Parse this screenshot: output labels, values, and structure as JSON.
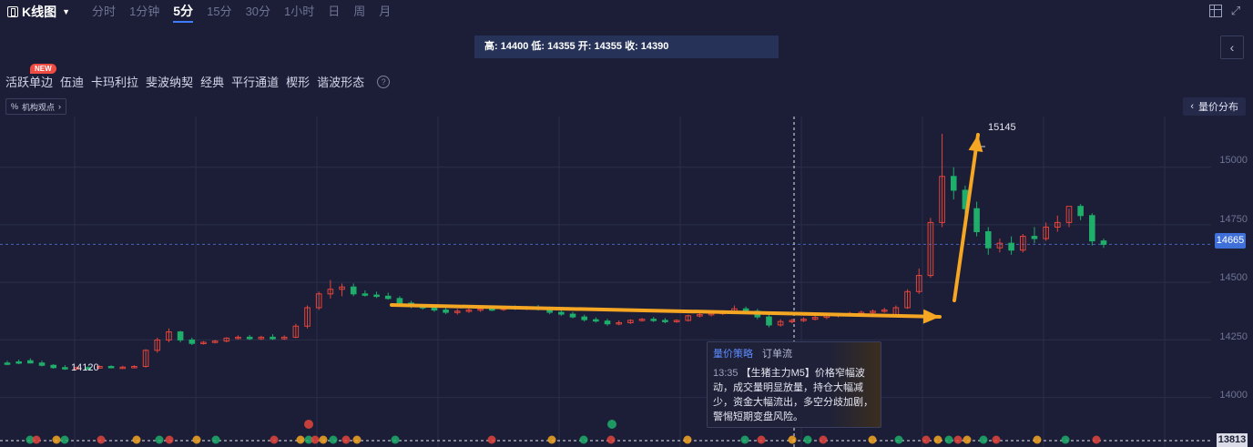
{
  "header": {
    "title": "K线图",
    "periods": [
      "分时",
      "1分钟",
      "5分",
      "15分",
      "30分",
      "1小时",
      "日",
      "周",
      "月"
    ],
    "active_period": "5分"
  },
  "info_bar": {
    "text": "高: 14400 低: 14355 开: 14355 收: 14390"
  },
  "tools": {
    "items": [
      "活跃单边",
      "伍迪",
      "卡玛利拉",
      "斐波纳契",
      "经典",
      "平行通道",
      "楔形",
      "谐波形态"
    ],
    "new_badge": "NEW",
    "help": "?"
  },
  "jigou": {
    "label": "机构观点",
    "prefix": "%"
  },
  "liangjia": {
    "label": "量价分布"
  },
  "price_axis": {
    "labels": [
      "15000",
      "14750",
      "14500",
      "14250",
      "14000"
    ],
    "current_price": "14665",
    "bottom_price": "13813"
  },
  "annotations": {
    "high": "15145",
    "low": "14120"
  },
  "tooltip": {
    "tabs": [
      "量价策略",
      "订单流"
    ],
    "time": "13:35",
    "text_line1": "【生猪主力M5】价格窄幅波",
    "text_line2": "动，成交量明显放量，持仓大幅减",
    "text_line3": "少，资金大幅流出，多空分歧加剧，",
    "text_line4": "警惕短期变盘风险。"
  },
  "colors": {
    "up": "#e2453c",
    "down": "#1fae6b",
    "arrow": "#f5a623",
    "bg": "#1b1e36",
    "accent": "#3f6fd9"
  },
  "chart_data": {
    "type": "candlestick",
    "ylim": [
      13813,
      15220
    ],
    "high": 15145,
    "low": 14120,
    "current": 14665,
    "candles": [
      [
        14150,
        14160,
        14145,
        14140
      ],
      [
        14155,
        14165,
        14150,
        14145
      ],
      [
        14160,
        14170,
        14150,
        14150
      ],
      [
        14150,
        14160,
        14140,
        14135
      ],
      [
        14140,
        14145,
        14130,
        14125
      ],
      [
        14130,
        14140,
        14125,
        14120
      ],
      [
        14125,
        14135,
        14130,
        14120
      ],
      [
        14130,
        14135,
        14125,
        14122
      ],
      [
        14128,
        14140,
        14135,
        14125
      ],
      [
        14135,
        14140,
        14130,
        14128
      ],
      [
        14130,
        14138,
        14132,
        14126
      ],
      [
        14132,
        14140,
        14135,
        14128
      ],
      [
        14135,
        14210,
        14205,
        14130
      ],
      [
        14205,
        14260,
        14250,
        14195
      ],
      [
        14250,
        14300,
        14285,
        14240
      ],
      [
        14285,
        14290,
        14250,
        14240
      ],
      [
        14250,
        14260,
        14235,
        14228
      ],
      [
        14235,
        14245,
        14240,
        14230
      ],
      [
        14240,
        14250,
        14245,
        14235
      ],
      [
        14245,
        14262,
        14258,
        14240
      ],
      [
        14258,
        14270,
        14262,
        14252
      ],
      [
        14262,
        14272,
        14255,
        14250
      ],
      [
        14255,
        14268,
        14262,
        14250
      ],
      [
        14262,
        14275,
        14255,
        14250
      ],
      [
        14255,
        14270,
        14262,
        14250
      ],
      [
        14262,
        14320,
        14310,
        14258
      ],
      [
        14310,
        14400,
        14390,
        14300
      ],
      [
        14390,
        14460,
        14450,
        14380
      ],
      [
        14450,
        14510,
        14470,
        14430
      ],
      [
        14470,
        14495,
        14480,
        14440
      ],
      [
        14480,
        14495,
        14450,
        14440
      ],
      [
        14450,
        14465,
        14445,
        14438
      ],
      [
        14445,
        14460,
        14440,
        14432
      ],
      [
        14440,
        14455,
        14430,
        14425
      ],
      [
        14430,
        14440,
        14410,
        14402
      ],
      [
        14410,
        14420,
        14395,
        14388
      ],
      [
        14395,
        14405,
        14390,
        14382
      ],
      [
        14390,
        14400,
        14380,
        14372
      ],
      [
        14380,
        14390,
        14370,
        14362
      ],
      [
        14370,
        14385,
        14375,
        14360
      ],
      [
        14375,
        14390,
        14380,
        14368
      ],
      [
        14380,
        14392,
        14385,
        14372
      ],
      [
        14385,
        14395,
        14382,
        14375
      ],
      [
        14382,
        14398,
        14392,
        14376
      ],
      [
        14392,
        14400,
        14386,
        14380
      ],
      [
        14386,
        14398,
        14392,
        14380
      ],
      [
        14392,
        14402,
        14388,
        14378
      ],
      [
        14388,
        14395,
        14370,
        14362
      ],
      [
        14370,
        14380,
        14362,
        14355
      ],
      [
        14362,
        14372,
        14350,
        14344
      ],
      [
        14350,
        14360,
        14338,
        14330
      ],
      [
        14338,
        14348,
        14332,
        14325
      ],
      [
        14332,
        14342,
        14320,
        14312
      ],
      [
        14320,
        14335,
        14325,
        14314
      ],
      [
        14325,
        14340,
        14335,
        14320
      ],
      [
        14335,
        14345,
        14340,
        14330
      ],
      [
        14340,
        14350,
        14335,
        14328
      ],
      [
        14335,
        14345,
        14330,
        14322
      ],
      [
        14330,
        14340,
        14335,
        14325
      ],
      [
        14335,
        14360,
        14355,
        14330
      ],
      [
        14355,
        14370,
        14360,
        14348
      ],
      [
        14360,
        14375,
        14365,
        14352
      ],
      [
        14365,
        14380,
        14370,
        14358
      ],
      [
        14370,
        14400,
        14385,
        14362
      ],
      [
        14385,
        14395,
        14375,
        14365
      ],
      [
        14375,
        14385,
        14350,
        14340
      ],
      [
        14350,
        14360,
        14315,
        14305
      ],
      [
        14315,
        14340,
        14330,
        14308
      ],
      [
        14330,
        14342,
        14335,
        14322
      ],
      [
        14335,
        14348,
        14340,
        14328
      ],
      [
        14340,
        14355,
        14348,
        14335
      ],
      [
        14348,
        14362,
        14355,
        14340
      ],
      [
        14355,
        14368,
        14360,
        14348
      ],
      [
        14360,
        14372,
        14365,
        14352
      ],
      [
        14365,
        14378,
        14370,
        14358
      ],
      [
        14370,
        14382,
        14375,
        14362
      ],
      [
        14375,
        14390,
        14380,
        14368
      ],
      [
        14355,
        14400,
        14390,
        14355
      ],
      [
        14390,
        14470,
        14460,
        14385
      ],
      [
        14460,
        14560,
        14530,
        14450
      ],
      [
        14530,
        14780,
        14760,
        14520
      ],
      [
        14760,
        15145,
        14960,
        14740
      ],
      [
        14960,
        15000,
        14900,
        14860
      ],
      [
        14900,
        14920,
        14820,
        14780
      ],
      [
        14820,
        14850,
        14720,
        14700
      ],
      [
        14720,
        14740,
        14650,
        14620
      ],
      [
        14650,
        14690,
        14670,
        14630
      ],
      [
        14670,
        14700,
        14640,
        14620
      ],
      [
        14640,
        14710,
        14700,
        14630
      ],
      [
        14700,
        14740,
        14690,
        14670
      ],
      [
        14690,
        14760,
        14740,
        14680
      ],
      [
        14740,
        14790,
        14760,
        14720
      ],
      [
        14760,
        14820,
        14830,
        14740
      ],
      [
        14830,
        14840,
        14790,
        14770
      ],
      [
        14790,
        14800,
        14680,
        14660
      ],
      [
        14680,
        14690,
        14665,
        14650
      ]
    ]
  }
}
